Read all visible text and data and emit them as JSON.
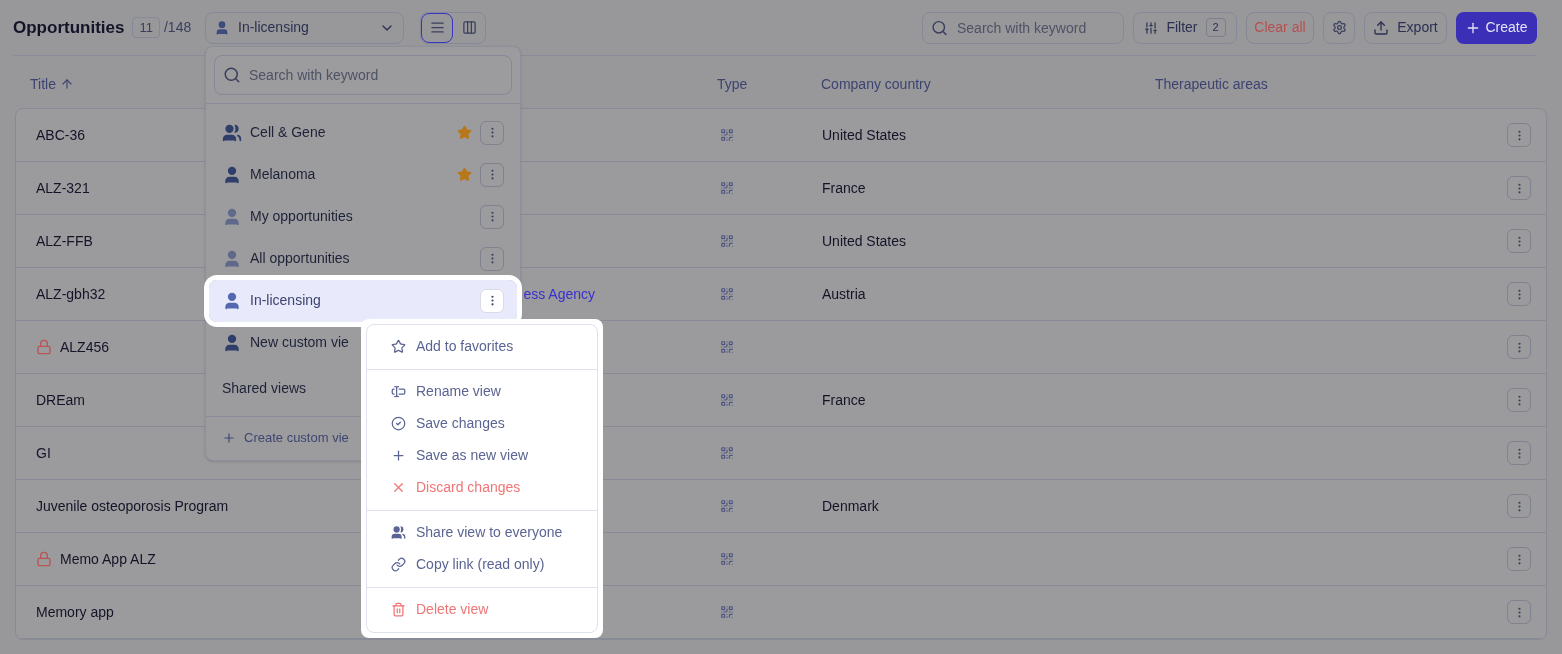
{
  "header": {
    "title": "Opportunities",
    "count": "11",
    "total": "/148",
    "view_select": "In-licensing",
    "layout_toggle": [
      {
        "kind": "list",
        "selected": true
      },
      {
        "kind": "columns",
        "selected": false
      }
    ],
    "search": {
      "placeholder": "Search with keyword"
    },
    "filter": {
      "label": "Filter",
      "count": "2"
    },
    "clear_all": "Clear all",
    "export": "Export",
    "create": "Create"
  },
  "table": {
    "columns": [
      {
        "label": "Title",
        "sorted": true
      },
      {
        "label": "Type"
      },
      {
        "label": "Company country"
      },
      {
        "label": "Therapeutic areas"
      }
    ],
    "rows": [
      {
        "title": "ABC-36",
        "locked": false,
        "country": "United States"
      },
      {
        "title": "ALZ-321",
        "locked": false,
        "country": "France"
      },
      {
        "title": "ALZ-FFB",
        "locked": false,
        "country": "United States"
      },
      {
        "title": "ALZ-gbh32",
        "locked": false,
        "company": {
          "text": "ess Agency",
          "kind": "tail"
        },
        "country": "Austria"
      },
      {
        "title": "ALZ456",
        "locked": true
      },
      {
        "title": "DREam",
        "locked": false,
        "country": "France"
      },
      {
        "title": "GI",
        "locked": false
      },
      {
        "title": "Juvenile osteoporosis Program",
        "locked": false,
        "country": "Denmark"
      },
      {
        "title": "Memo App ALZ",
        "locked": true
      },
      {
        "title": "Memory app",
        "locked": false
      }
    ]
  },
  "views_dropdown": {
    "search": {
      "placeholder": "Search with keyword"
    },
    "items": [
      {
        "label": "Cell & Gene",
        "kind": "group",
        "favorite": true,
        "selected": false
      },
      {
        "label": "Melanoma",
        "kind": "person",
        "favorite": true,
        "selected": false
      },
      {
        "label": "My opportunities",
        "kind": "system",
        "favorite": false,
        "selected": false
      },
      {
        "label": "All opportunities",
        "kind": "system",
        "favorite": false,
        "selected": false
      },
      {
        "label": "In-licensing",
        "kind": "person",
        "favorite": false,
        "selected": true
      },
      {
        "label": "New custom vie",
        "kind": "person",
        "favorite": false,
        "selected": false
      }
    ],
    "section": "Shared views",
    "create": "Create custom vie"
  },
  "context_menu": {
    "sections": [
      [
        {
          "label": "Add to favorites",
          "kind": "favorite",
          "danger": false
        }
      ],
      [
        {
          "label": "Rename view",
          "kind": "rename",
          "danger": false
        },
        {
          "label": "Save changes",
          "kind": "save",
          "danger": false
        },
        {
          "label": "Save as new view",
          "kind": "duplicate",
          "danger": false
        },
        {
          "label": "Discard changes",
          "kind": "discard",
          "danger": true
        }
      ],
      [
        {
          "label": "Share view to everyone",
          "kind": "share",
          "danger": false
        },
        {
          "label": "Copy link (read only)",
          "kind": "copy",
          "danger": false
        }
      ],
      [
        {
          "label": "Delete view",
          "kind": "delete",
          "danger": true
        }
      ]
    ]
  }
}
